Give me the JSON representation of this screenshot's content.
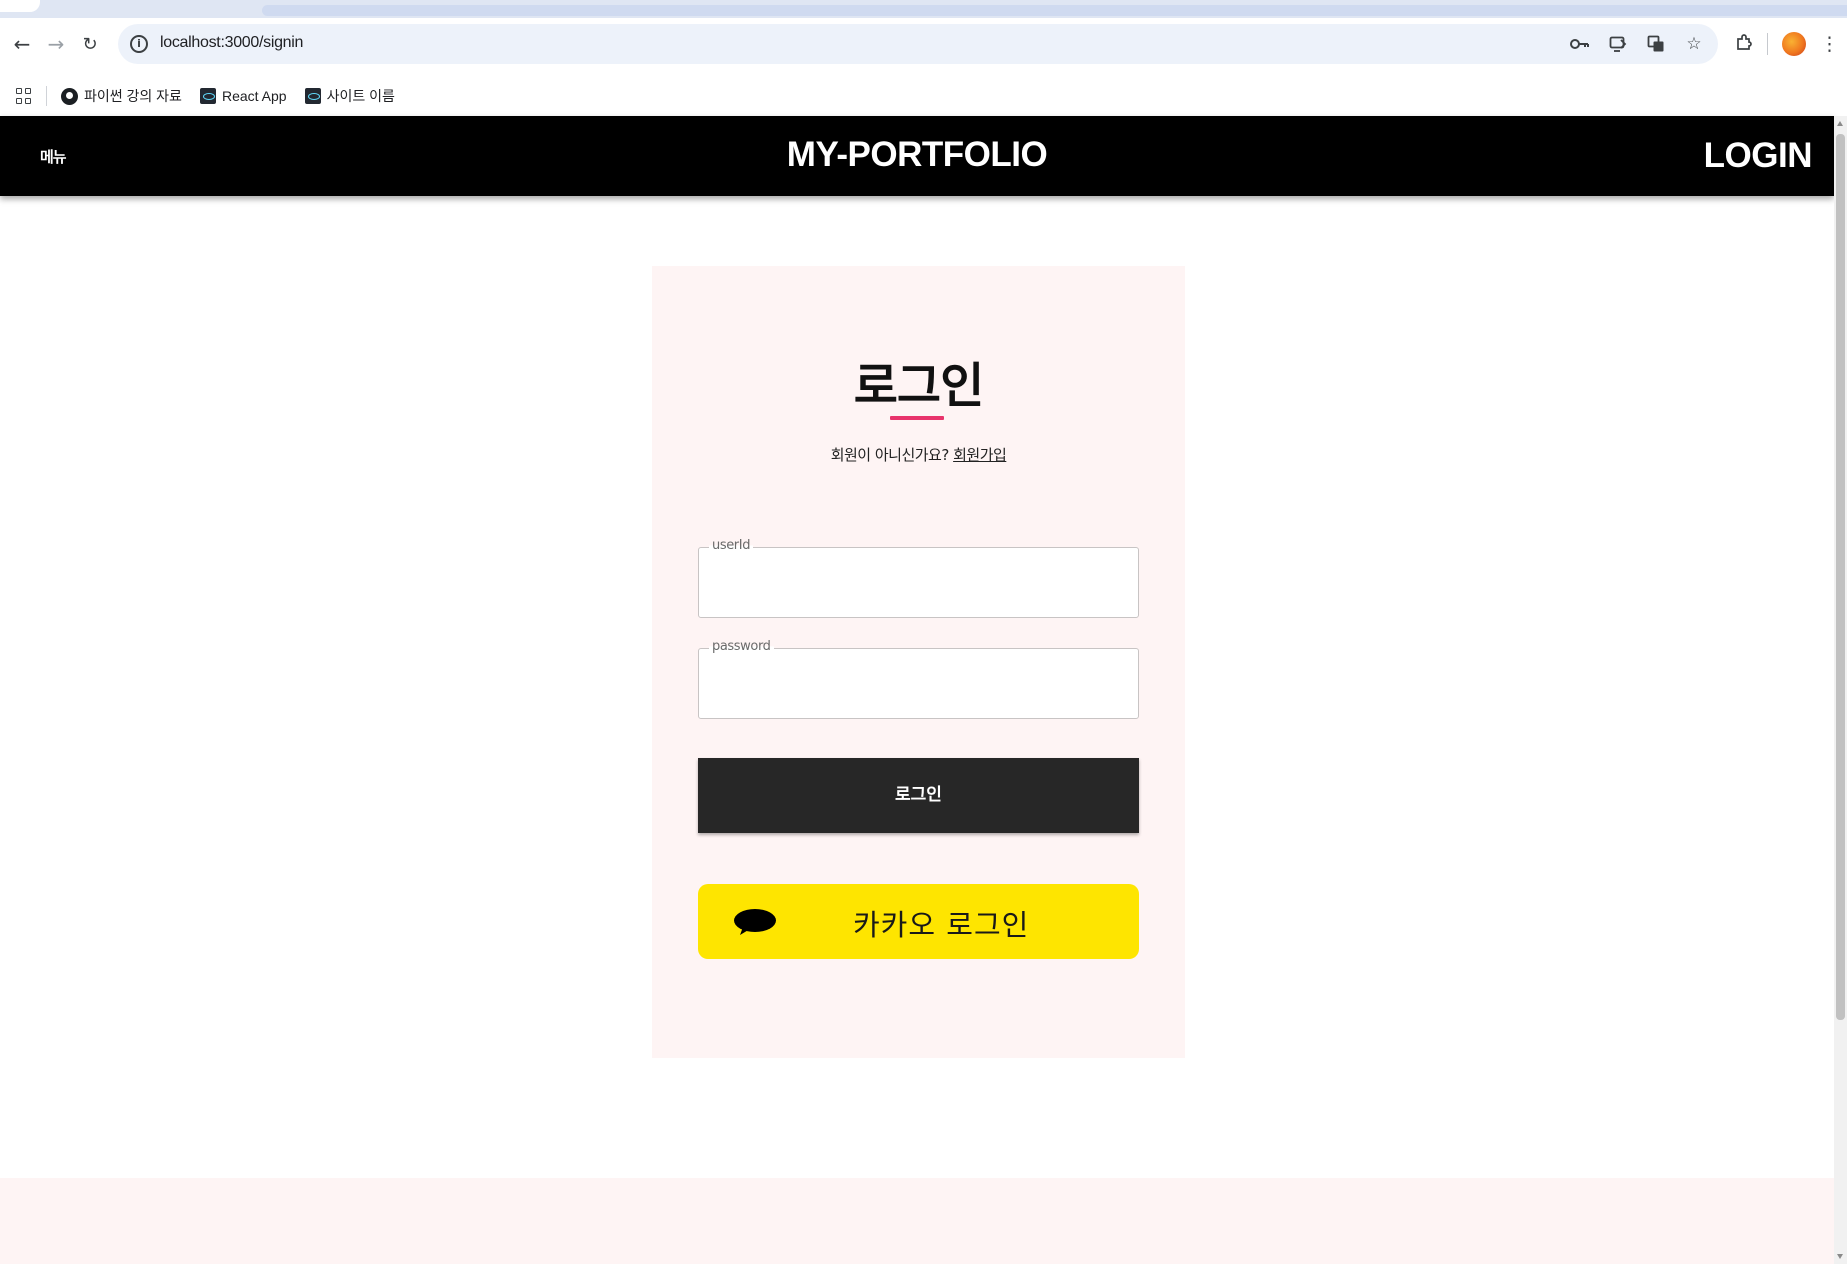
{
  "browser": {
    "url": "localhost:3000/signin",
    "bookmarks": [
      {
        "label": "파이썬 강의 자료"
      },
      {
        "label": "React App"
      },
      {
        "label": "사이트 이름"
      }
    ]
  },
  "header": {
    "menu_label": "메뉴",
    "brand": "MY-PORTFOLIO",
    "login_label": "LOGIN"
  },
  "login": {
    "title": "로그인",
    "signup_prompt": "회원이 아니신가요?",
    "signup_link": "회원가입",
    "userid_label": "userId",
    "password_label": "password",
    "submit_label": "로그인",
    "kakao_label": "카카오 로그인"
  },
  "colors": {
    "header_bg": "#000000",
    "card_bg": "#fef4f4",
    "accent_underline": "#e8336b",
    "login_button_bg": "#272727",
    "kakao_yellow": "#fee500"
  }
}
